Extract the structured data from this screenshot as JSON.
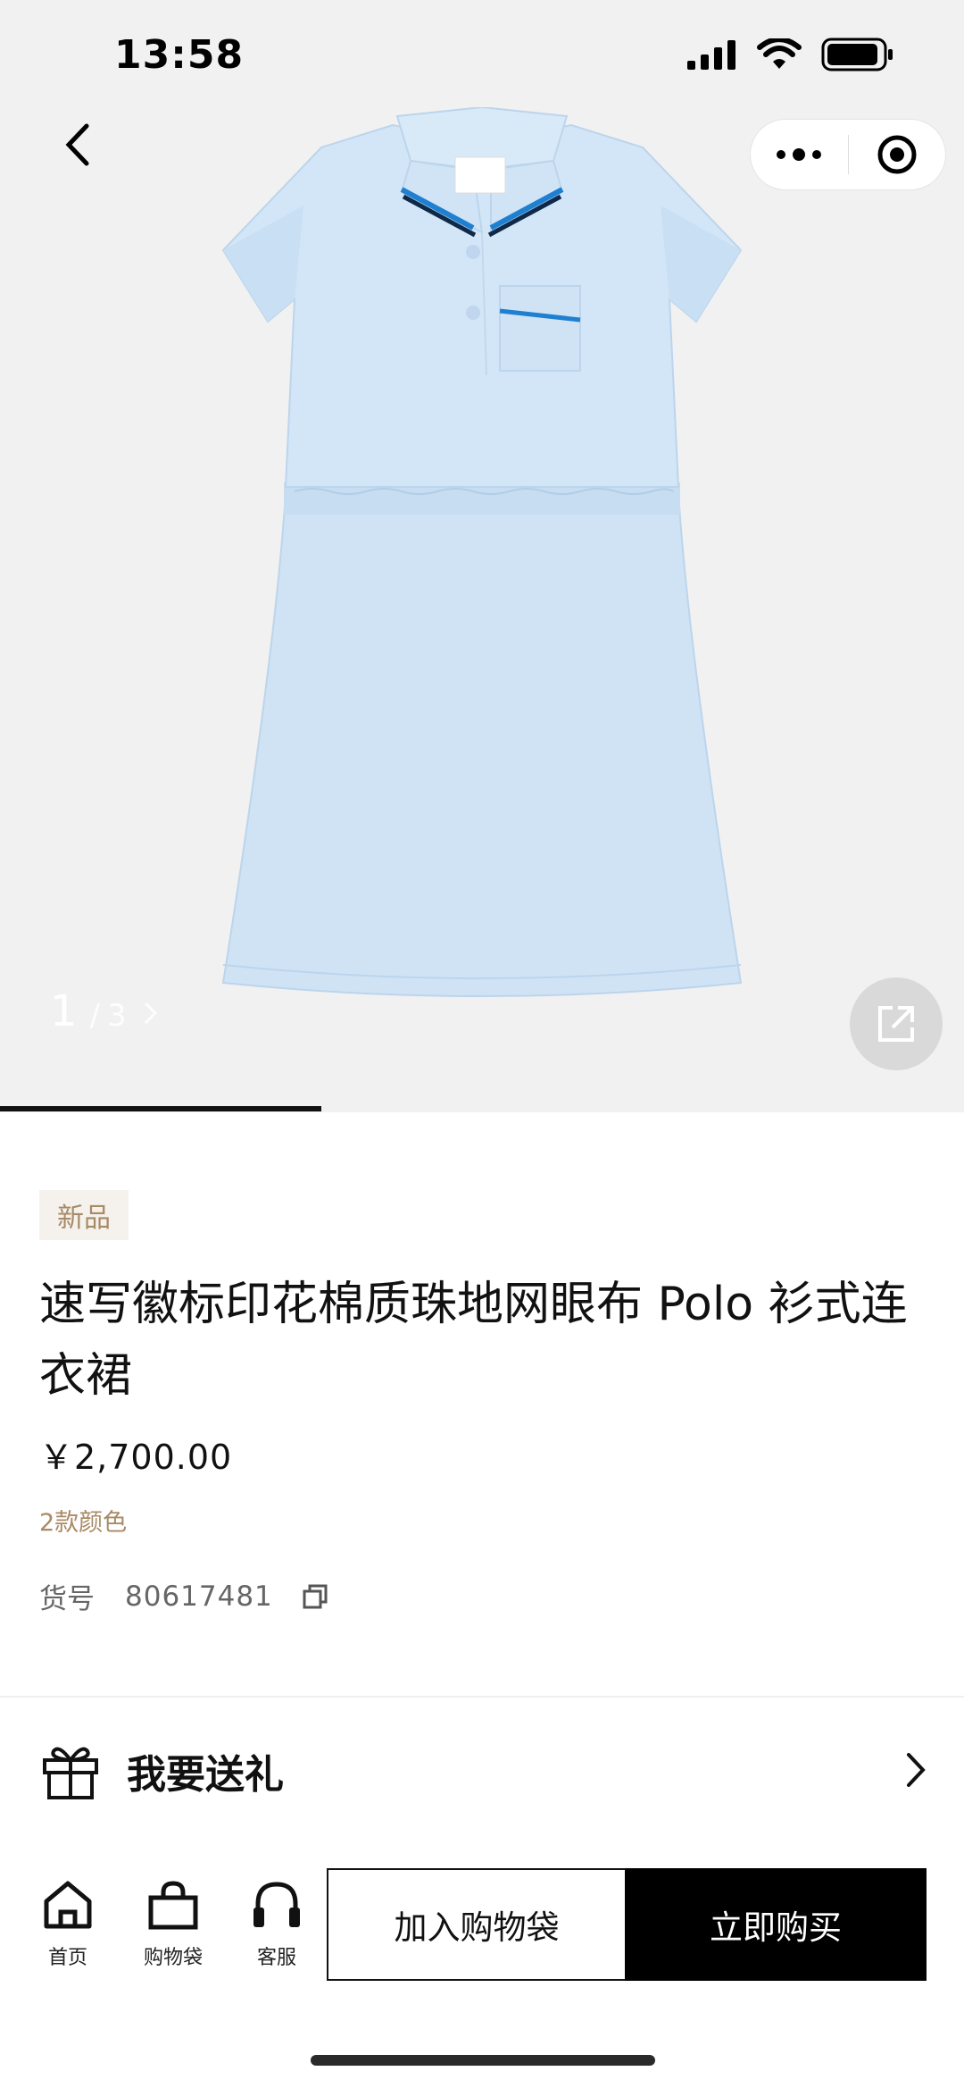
{
  "status_bar": {
    "time": "13:58"
  },
  "gallery": {
    "current": "1",
    "separator": "/",
    "total": "3",
    "progress_fraction": 0.333,
    "background_color": "#f1f1f1"
  },
  "product": {
    "badge": "新品",
    "title": "速写徽标印花棉质珠地网眼布 Polo 衫式连衣裙",
    "price": "￥2,700.00",
    "colors": "2款颜色",
    "sku_label": "货号",
    "sku_value": "80617481"
  },
  "gift": {
    "label": "我要送礼"
  },
  "bottom_nav": {
    "items": [
      {
        "label": "首页",
        "icon": "home-icon"
      },
      {
        "label": "购物袋",
        "icon": "shopping-bag-icon"
      },
      {
        "label": "客服",
        "icon": "headset-icon"
      }
    ],
    "add_to_bag": "加入购物袋",
    "buy_now": "立即购买"
  },
  "colors": {
    "accent_gold": "#a88a66",
    "badge_bg": "#f5f1ec",
    "buy_button": "#000000",
    "dress": "#cfe3f5",
    "collar_stripe": "#1f7fd1"
  }
}
